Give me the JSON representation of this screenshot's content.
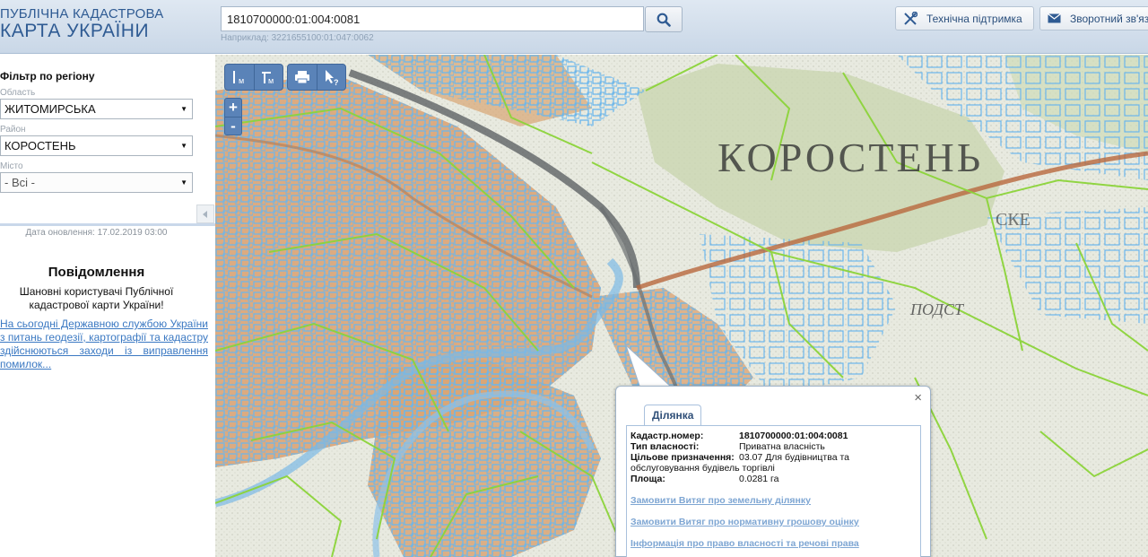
{
  "header": {
    "logo_line1": "ПУБЛІЧНА КАДАСТРОВА",
    "logo_line2": "КАРТА УКРАЇНИ",
    "search_value": "1810700000:01:004:0081",
    "search_example": "Наприклад: 3221655100:01:047:0062",
    "support_label": "Технічна підтримка",
    "feedback_label": "Зворотний зв'язок"
  },
  "sidebar": {
    "filter_title": "Фільтр по регіону",
    "oblast_label": "Область",
    "oblast_value": "ЖИТОМИРСЬКА",
    "rayon_label": "Район",
    "rayon_value": "КОРОСТЕНЬ",
    "city_label": "Місто",
    "city_value": "- Всі -",
    "update_date": "Дата оновлення: 17.02.2019 03:00",
    "notice_title": "Повідомлення",
    "notice_greeting": "Шановні користувачі Публічної кадастрової карти України!",
    "notice_link": "На сьогодні Державною службою України з питань геодезії, картографії та кадастру здійснюються заходи із виправлення помилок..."
  },
  "map": {
    "label_town": "КОРОСТЕНЬ",
    "label_small": "ПОДСТ",
    "label_ske": "СКЕ",
    "toolbar": [
      "measure-length",
      "measure-area",
      "print",
      "identify"
    ],
    "zoom_in": "+",
    "zoom_out": "-"
  },
  "popup": {
    "tab_label": "Ділянка",
    "rows": [
      {
        "key": "Кадастр.номер:",
        "value": "1810700000:01:004:0081"
      },
      {
        "key": "Тип власності:",
        "value": "Приватна власність"
      },
      {
        "key": "Цільове призначення:",
        "value": "03.07 Для будівництва та обслуговування будівель торгівлі"
      },
      {
        "key": "Площа:",
        "value": "0.0281 га"
      }
    ],
    "purpose_line1": "03.07 Для будівництва та",
    "purpose_line2": "обслуговування будівель торгівлі",
    "links": [
      "Замовити Витяг про земельну ділянку",
      "Замовити Витяг про нормативну грошову оцінку",
      "Інформація про право власності та речові права"
    ],
    "close": "×"
  },
  "colors": {
    "parcel_blue": "#5fb1ea",
    "boundary_green": "#8cd43a",
    "urban_orange": "#d9a070",
    "toolbar_blue": "#5a83b8",
    "link_blue": "#3a78c2"
  }
}
